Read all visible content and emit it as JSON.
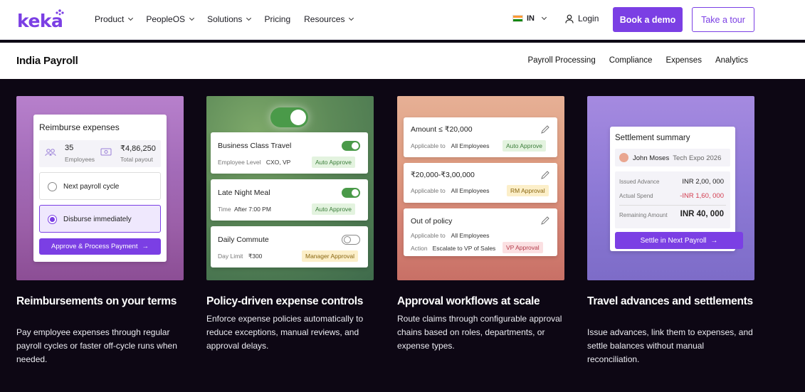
{
  "nav": {
    "logo": "keka",
    "menu": [
      "Product",
      "PeopleOS",
      "Solutions",
      "Pricing",
      "Resources"
    ],
    "menu_has_caret": [
      true,
      true,
      true,
      false,
      true
    ],
    "country": "IN",
    "login": "Login",
    "book_demo": "Book a demo",
    "take_tour": "Take a tour",
    "brand_color": "#7b3fe4"
  },
  "subnav": {
    "title": "India Payroll",
    "links": [
      "Payroll Processing",
      "Compliance",
      "Expenses",
      "Analytics"
    ]
  },
  "card1": {
    "panel_title": "Reimburse expenses",
    "employees_value": "35",
    "employees_label": "Employees",
    "payout_value": "₹4,86,250",
    "payout_label": "Total payout",
    "option1": "Next payroll cycle",
    "option2": "Disburse immediately",
    "cta": "Approve & Process Payment",
    "caption_title": "Reimbursements on your terms",
    "caption_body": "Pay employee expenses through regular payroll cycles or faster off-cycle runs when needed."
  },
  "card2": {
    "policies": [
      {
        "title": "Business Class Travel",
        "meta_label": "Employee Level",
        "meta_value": "CXO, VP",
        "tag": "Auto Approve",
        "on": true
      },
      {
        "title": "Late Night Meal",
        "meta_label": "Time",
        "meta_value": "After 7:00 PM",
        "tag": "Auto Approve",
        "on": true
      },
      {
        "title": "Daily Commute",
        "meta_label": "Day Limit",
        "meta_value": "₹300",
        "tag": "Manager Approval",
        "on": false
      }
    ],
    "caption_title": "Policy-driven expense controls",
    "caption_body": "Enforce expense policies automatically to reduce exceptions, manual reviews, and approval delays."
  },
  "card3": {
    "rules": [
      {
        "title": "Amount ≤ ₹20,000",
        "applicable_label": "Applicable to",
        "applicable_value": "All Employees",
        "tag": "Auto Approve"
      },
      {
        "title": "₹20,000-₹3,00,000",
        "applicable_label": "Applicable to",
        "applicable_value": "All Employees",
        "tag": "RM Approval"
      },
      {
        "title": "Out of policy",
        "applicable_label": "Applicable to",
        "applicable_value": "All Employees",
        "action_label": "Action",
        "action_value": "Escalate to VP of Sales",
        "tag": "VP Approval"
      }
    ],
    "caption_title": "Approval workflows at scale",
    "caption_body": "Route claims through configurable approval chains based on roles, departments, or expense types."
  },
  "card4": {
    "panel_title": "Settlement summary",
    "person": "John Moses",
    "event": "Tech Expo 2026",
    "issued_label": "Issued Advance",
    "issued_value": "INR 2,00, 000",
    "spend_label": "Actual Spend",
    "spend_value": "-INR 1,60, 000",
    "remaining_label": "Remaining Amount",
    "remaining_value": "INR 40, 000",
    "cta": "Settle in Next Payroll",
    "caption_title": "Travel advances and settlements",
    "caption_body": "Issue advances, link them to expenses, and settle balances without manual reconciliation."
  }
}
